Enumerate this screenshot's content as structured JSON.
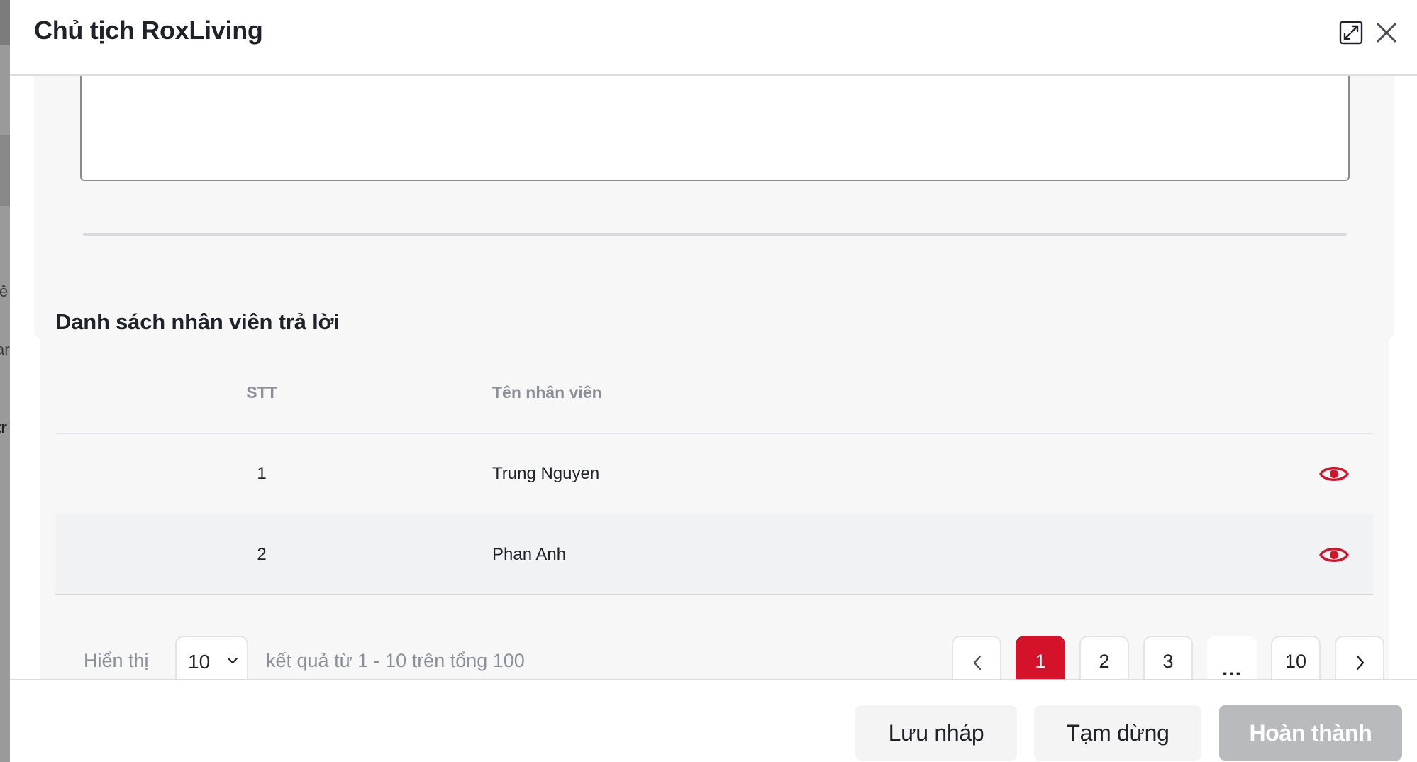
{
  "background": {
    "fragments": [
      "iê",
      "ar",
      "tr"
    ]
  },
  "modal": {
    "title": "Chủ tịch RoxLiving",
    "icons": {
      "expand": "expand-icon",
      "close": "close-icon"
    }
  },
  "note_field": {
    "value": "",
    "placeholder": ""
  },
  "employee_list": {
    "title": "Danh sách nhân viên trả lời",
    "columns": {
      "stt": "STT",
      "name": "Tên nhân viên"
    },
    "rows": [
      {
        "stt": "1",
        "name": "Trung Nguyen",
        "action_icon": "eye-icon"
      },
      {
        "stt": "2",
        "name": "Phan Anh",
        "action_icon": "eye-icon"
      }
    ]
  },
  "pagination": {
    "show_label": "Hiển thị",
    "page_size": "10",
    "result_text": "kết quả từ 1 - 10 trên tổng 100",
    "pages": [
      "1",
      "2",
      "3",
      "...",
      "10"
    ],
    "current_page": "1",
    "icons": {
      "prev": "chevron-left-icon",
      "next": "chevron-right-icon",
      "dropdown": "chevron-down-icon"
    }
  },
  "footer": {
    "save_draft": "Lưu nháp",
    "pause": "Tạm dừng",
    "complete": "Hoàn thành"
  },
  "colors": {
    "accent": "#d4122a",
    "disabled_button": "#b9babd",
    "card_background": "#f7f7f8"
  }
}
